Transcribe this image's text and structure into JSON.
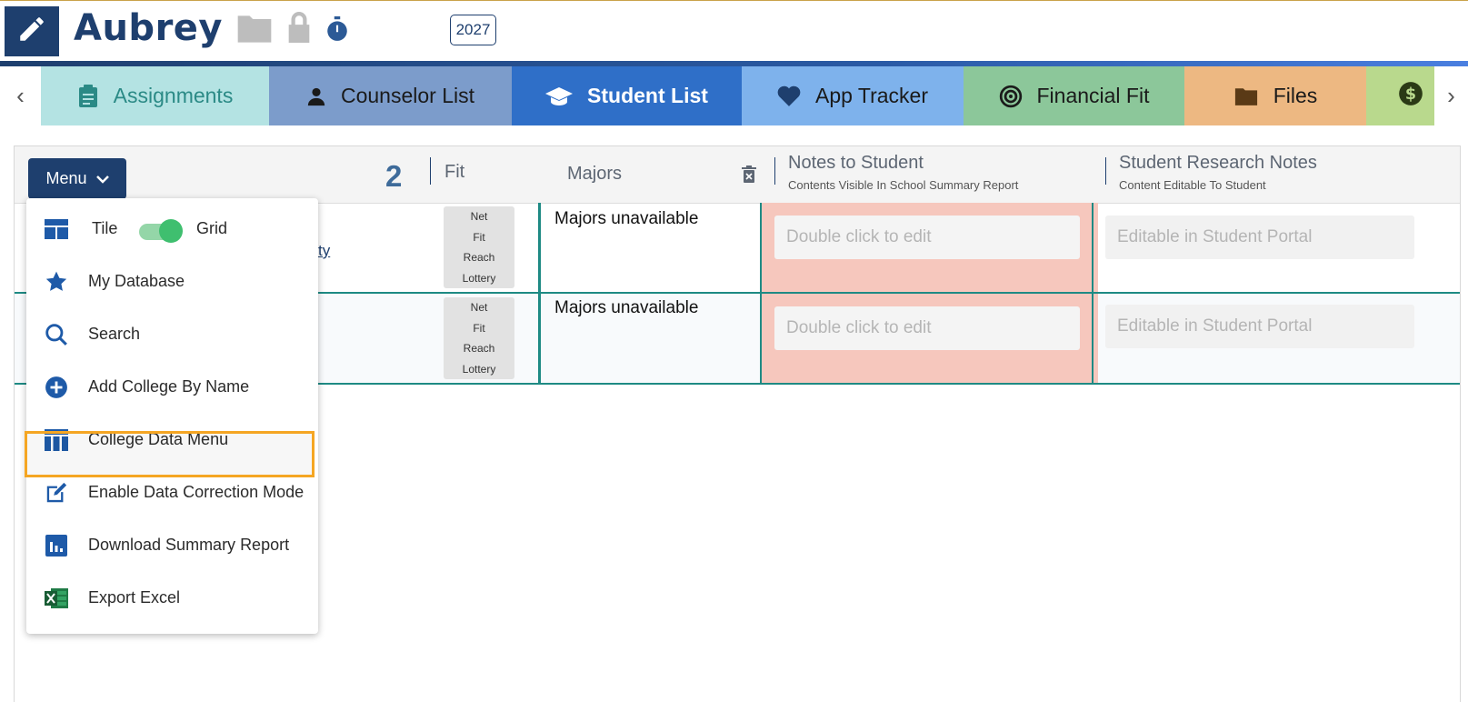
{
  "header": {
    "student_name": "Aubrey",
    "year": "2027",
    "icons": [
      "pencil-icon",
      "folder-icon",
      "lock-icon",
      "stopwatch-icon"
    ]
  },
  "tabs": [
    {
      "label": "Assignments",
      "icon": "clipboard-icon",
      "bg": "#b4e3e3",
      "fg": "#2b8a86"
    },
    {
      "label": "Counselor List",
      "icon": "person-icon",
      "bg": "#7c9ccb",
      "fg": "#1a1a1a"
    },
    {
      "label": "Student List",
      "icon": "graduation-cap-icon",
      "bg": "#2f6fc8",
      "fg": "#ffffff",
      "active": true
    },
    {
      "label": "App Tracker",
      "icon": "heart-icon",
      "bg": "#7eb2ec",
      "fg": "#1a1a1a"
    },
    {
      "label": "Financial Fit",
      "icon": "target-icon",
      "bg": "#8cc79a",
      "fg": "#1a1a1a"
    },
    {
      "label": "Files",
      "icon": "folder-icon",
      "bg": "#edb882",
      "fg": "#1a1a1a"
    },
    {
      "label": "",
      "icon": "dollar-icon",
      "bg": "#b9d98d",
      "fg": "#1a1a1a"
    }
  ],
  "toolbar": {
    "menu_label": "Menu",
    "count": "2"
  },
  "table": {
    "headers": {
      "fit": "Fit",
      "majors": "Majors",
      "notes": "Notes to Student",
      "notes_sub": "Contents Visible In School Summary Report",
      "research": "Student Research Notes",
      "research_sub": "Content Editable To Student"
    },
    "fit_options": [
      "Net",
      "Fit",
      "Reach",
      "Lottery"
    ],
    "rows": [
      {
        "college_fragment": "ty",
        "majors": "Majors unavailable",
        "notes_placeholder": "Double click to edit",
        "research_placeholder": "Editable in Student Portal"
      },
      {
        "college_fragment": "",
        "majors": "Majors unavailable",
        "notes_placeholder": "Double click to edit",
        "research_placeholder": "Editable in Student Portal"
      }
    ]
  },
  "menu": {
    "view_toggle": {
      "left": "Tile",
      "right": "Grid",
      "state": "Grid"
    },
    "items": [
      {
        "label": "My Database",
        "icon": "star-icon"
      },
      {
        "label": "Search",
        "icon": "search-icon"
      },
      {
        "label": "Add College By Name",
        "icon": "plus-circle-icon"
      },
      {
        "label": "College Data Menu",
        "icon": "table-icon",
        "highlighted": true
      },
      {
        "label": "Enable Data Correction Mode",
        "icon": "edit-square-icon"
      },
      {
        "label": "Download Summary Report",
        "icon": "bar-chart-icon"
      },
      {
        "label": "Export Excel",
        "icon": "excel-icon"
      }
    ]
  },
  "colors": {
    "navy": "#1e3f6e",
    "teal": "#1e8a84",
    "highlight": "#f5a623",
    "notes_bg": "#f6c7bd",
    "toggle": "#3fbf6f"
  }
}
